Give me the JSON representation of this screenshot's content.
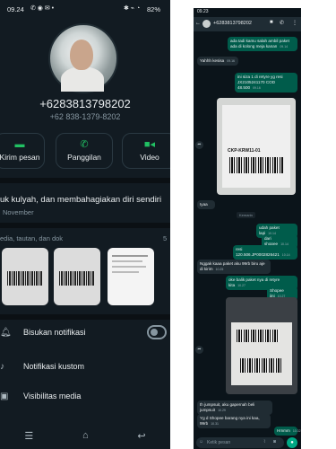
{
  "left": {
    "status": {
      "time": "09.24",
      "battery": "82%"
    },
    "contact": {
      "phone_main": "+6283813798202",
      "phone_sub": "+62 838-1379-8202"
    },
    "actions": [
      {
        "label": "Kirim pesan",
        "icon": "message-icon"
      },
      {
        "label": "Panggilan",
        "icon": "phone-icon"
      },
      {
        "label": "Video",
        "icon": "video-icon"
      }
    ],
    "about": {
      "text": "uk kulyah, dan membahagiakan diri sendiri",
      "date": "November"
    },
    "media": {
      "label": "edia, tautan, dan dok",
      "count": "5"
    },
    "settings": [
      {
        "label": "Bisukan notifikasi",
        "icon": "bell-icon"
      },
      {
        "label": "Notifikasi kustom",
        "icon": "music-note-icon"
      },
      {
        "label": "Visibilitas media",
        "icon": "image-icon"
      }
    ]
  },
  "right": {
    "status": {
      "time": "09.23"
    },
    "header": {
      "name": "+6283813798202"
    },
    "messages": {
      "m1": "ada tadi kamu salah ambil paket ada di kolong meja kanan",
      "m2": "Yahhh kesisa",
      "m3": "ini siza 1 di retyre yg resi JX2105241170 COD 48.500",
      "m4": "Iyaa",
      "m5": "Kemarin",
      "m6": "udah paket lagi",
      "m7": "dari shopee",
      "m8": "resi 120.506.JP0002826421",
      "m9": "Nggak kaaa paket aku 99rb biru aje di kirim",
      "m10": "oke balik paket nya di retyre kita",
      "m11": "Shopee iini",
      "m12": "th jumpsuit, aku gapernah beli jumpsuit",
      "m13": "Yg d Shopee barang nya ini kaa, 99rb",
      "m14": "Hmmm",
      "label_code": "CKP-KRW11-01",
      "input_placeholder": "Ketik pesan"
    },
    "times": [
      "09.14",
      "09.16",
      "09.16",
      "10.14",
      "10.14",
      "10.14",
      "10.25",
      "10.27",
      "10.27",
      "10.29",
      "10.31",
      "10.32",
      "10.33"
    ]
  }
}
